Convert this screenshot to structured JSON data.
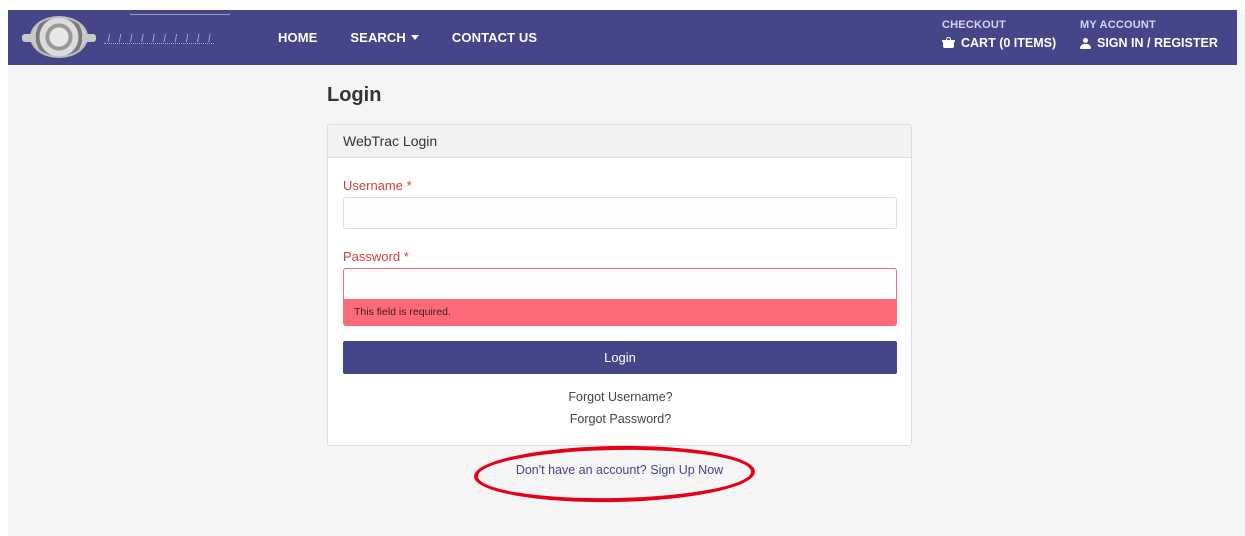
{
  "nav": {
    "home": "HOME",
    "search": "SEARCH",
    "contact": "CONTACT US",
    "checkout_label": "CHECKOUT",
    "cart": "CART (0 ITEMS)",
    "account_label": "MY ACCOUNT",
    "signin": "SIGN IN / REGISTER",
    "bar_color": "#45458a"
  },
  "page": {
    "title": "Login"
  },
  "login_panel": {
    "header": "WebTrac Login",
    "username_label": "Username *",
    "username_value": "",
    "password_label": "Password *",
    "password_value": "",
    "error": "This field is required.",
    "login_button": "Login",
    "forgot_username": "Forgot Username?",
    "forgot_password": "Forgot Password?"
  },
  "signup": {
    "text": "Don't have an account? Sign Up Now"
  },
  "icons": {
    "logo": "city-seal-logo",
    "cart": "basket-icon",
    "account": "user-icon",
    "search_dropdown": "caret-down-icon"
  },
  "colors": {
    "error_bg": "#ff6a78",
    "required_label": "#d43f3a",
    "annotation": "#e5001a"
  }
}
